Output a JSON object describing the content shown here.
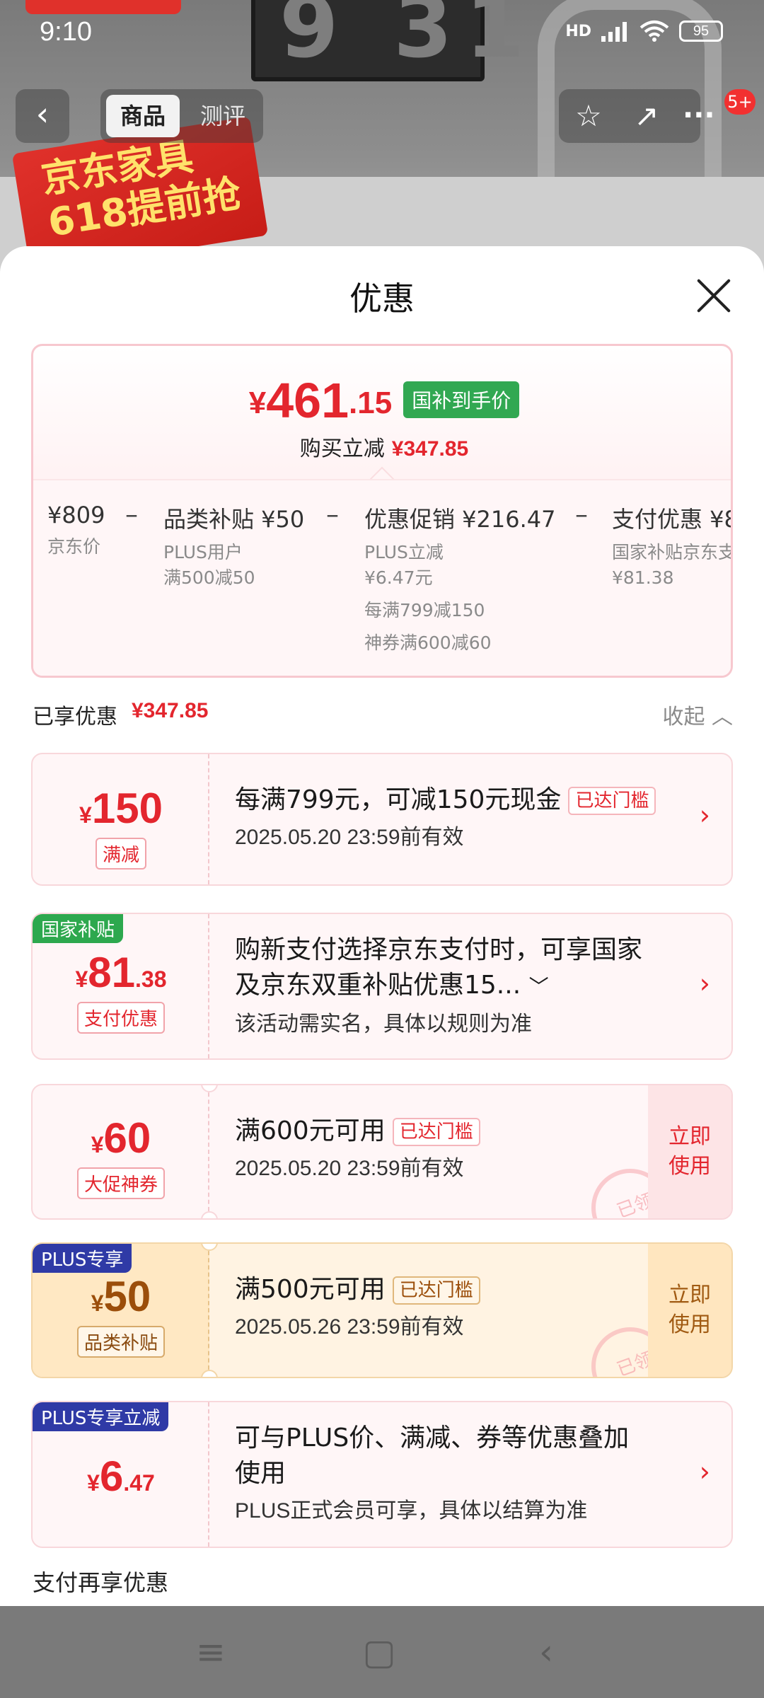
{
  "status_bar": {
    "time": "9:10",
    "network": "HD",
    "battery": "95"
  },
  "background": {
    "banner_text": "京东家具618提前抢"
  },
  "navbar": {
    "tabs": [
      {
        "label": "商品",
        "active": true
      },
      {
        "label": "测评",
        "active": false
      }
    ],
    "badge": "5+"
  },
  "sheet": {
    "title": "优惠",
    "summary": {
      "price_yen": "¥",
      "price_int": "461",
      "price_dec": ".15",
      "price_tag": "国补到手价",
      "reduce_label": "购买立减",
      "reduce_amount": "¥347.85",
      "breakdown": [
        {
          "title": "¥809",
          "subs": [
            "京东价"
          ]
        },
        {
          "title": "品类补贴 ¥50",
          "subs": [
            "PLUS用户",
            "满500减50"
          ]
        },
        {
          "title": "优惠促销 ¥216.47",
          "subs": [
            "PLUS立减",
            "¥6.47元",
            "每满799减150",
            "神券满600减60"
          ]
        },
        {
          "title": "支付优惠 ¥8",
          "subs": [
            "国家补贴京东支",
            "¥81.38"
          ]
        }
      ],
      "minus": "–"
    },
    "enjoyed": {
      "label": "已享优惠",
      "amount": "¥347.85",
      "collapse": "收起"
    },
    "cards": [
      {
        "amount_yen": "¥",
        "amount_int": "150",
        "amount_dec": "",
        "tag": "满减",
        "title": "每满799元，可减150元现金",
        "threshold": "已达门槛",
        "sub": "2025.05.20 23:59前有效"
      },
      {
        "badge": "国家补贴",
        "amount_yen": "¥",
        "amount_int": "81",
        "amount_dec": ".38",
        "tag": "支付优惠",
        "title_line1": "购新支付选择京东支付时，可享国家",
        "title_line2": "及京东双重补贴优惠15...",
        "sub": "该活动需实名，具体以规则为准"
      },
      {
        "amount_yen": "¥",
        "amount_int": "60",
        "amount_dec": "",
        "tag": "大促神券",
        "title": "满600元可用",
        "threshold": "已达门槛",
        "sub": "2025.05.20 23:59前有效",
        "use_line1": "立即",
        "use_line2": "使用",
        "stamp": "已领"
      },
      {
        "badge": "PLUS专享",
        "amount_yen": "¥",
        "amount_int": "50",
        "amount_dec": "",
        "tag": "品类补贴",
        "title": "满500元可用",
        "threshold": "已达门槛",
        "sub": "2025.05.26 23:59前有效",
        "use_line1": "立即",
        "use_line2": "使用",
        "stamp": "已领"
      },
      {
        "badge": "PLUS专享立减",
        "amount_yen": "¥",
        "amount_int": "6",
        "amount_dec": ".47",
        "title_line1": "可与PLUS价、满减、券等优惠叠加",
        "title_line2": "使用",
        "sub": "PLUS正式会员可享，具体以结算为准"
      }
    ],
    "pay_more": "支付再享优惠"
  },
  "colors": {
    "accent_red": "#e3262e",
    "green_tag": "#31a852",
    "plus_blue": "#2f3aa6",
    "plus_gold": "#9b4e0a"
  }
}
